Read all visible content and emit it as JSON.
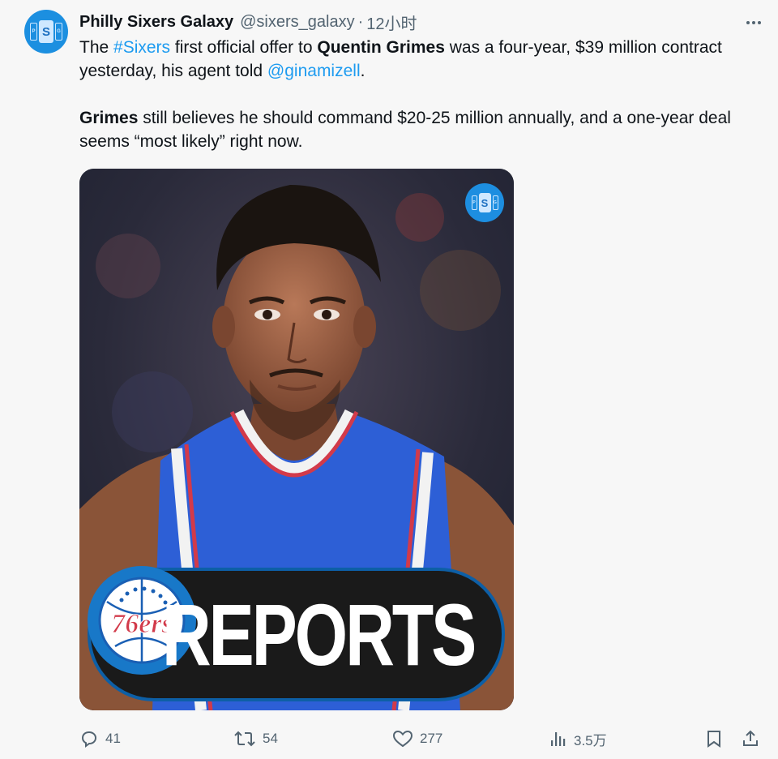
{
  "tweet": {
    "author_name": "Philly Sixers Galaxy",
    "handle": "@sixers_galaxy",
    "separator": "·",
    "time": "12小时",
    "paragraph1": {
      "t1": "The ",
      "hashtag": "#Sixers",
      "t2": " first official offer to ",
      "name": "Quentin Grimes",
      "t3": " was a four-year, $39 million contract yesterday, his agent told ",
      "mention": "@ginamizell",
      "t4": "."
    },
    "paragraph2": {
      "name": "Grimes",
      "t1": " still believes he should command $20-25 million annually, and a one-year deal seems “most likely” right now."
    }
  },
  "avatar_logo": {
    "left": "P",
    "center": "S",
    "right": "G"
  },
  "media": {
    "corner_logo": {
      "left": "P",
      "center": "S",
      "right": "G"
    },
    "banner_text": "REPORTS",
    "team_logo_text": "76ers"
  },
  "actions": {
    "reply_count": "41",
    "retweet_count": "54",
    "like_count": "277",
    "views_count": "3.5万"
  },
  "colors": {
    "link": "#1d9bf0",
    "muted": "#536471",
    "jersey_blue": "#2d5fd6",
    "jersey_stripe_red": "#d23a4a"
  }
}
